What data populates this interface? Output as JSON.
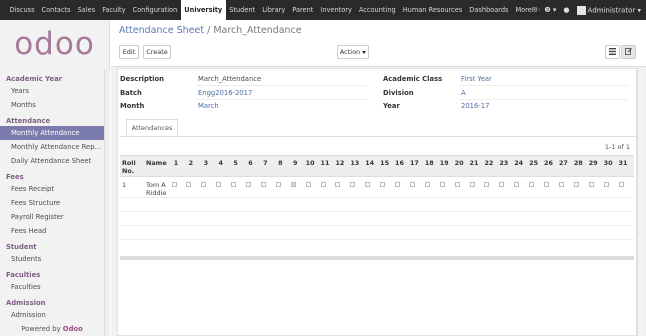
{
  "topnav": {
    "items": [
      "Discuss",
      "Contacts",
      "Sales",
      "Faculty",
      "Configuration",
      "University",
      "Student",
      "Library",
      "Parent",
      "Inventory",
      "Accounting",
      "Human Resources",
      "Dashboards",
      "More"
    ],
    "active": "University",
    "user": "Administrator",
    "icons": [
      "mail-icon",
      "help-icon",
      "chat-icon",
      "avatar"
    ]
  },
  "logo": "odoo",
  "sidebar": {
    "sections": [
      {
        "title": "Academic Year",
        "items": [
          "Years",
          "Months"
        ]
      },
      {
        "title": "Attendance",
        "items": [
          "Monthly Attendance",
          "Monthly Attendance Rep...",
          "Daily Attendance Sheet"
        ]
      },
      {
        "title": "Fees",
        "items": [
          "Fees Receipt",
          "Fees Structure",
          "Payroll Register",
          "Fees Head"
        ]
      },
      {
        "title": "Student",
        "items": [
          "Students"
        ]
      },
      {
        "title": "Faculties",
        "items": [
          "Faculties"
        ]
      },
      {
        "title": "Admission",
        "items": [
          "Admission"
        ]
      }
    ],
    "active_item": "Monthly Attendance",
    "powered_prefix": "Powered by",
    "powered_brand": "Odoo"
  },
  "breadcrumb": {
    "parent": "Attendance Sheet",
    "separator": "/",
    "current": "March_Attendance"
  },
  "toolbar": {
    "edit": "Edit",
    "create": "Create",
    "action": "Action",
    "list_icon": "list-icon",
    "form_icon": "edit-form-icon"
  },
  "form": {
    "description_label": "Description",
    "description_value": "March_Attendance",
    "batch_label": "Batch",
    "batch_value": "Engg2016-2017",
    "month_label": "Month",
    "month_value": "March",
    "academic_class_label": "Academic Class",
    "academic_class_value": "First Year",
    "division_label": "Division",
    "division_value": "A",
    "year_label": "Year",
    "year_value": "2016-17"
  },
  "tab": "Attendances",
  "pager": "1-1 of 1",
  "table": {
    "roll_label_1": "Roll",
    "roll_label_2": "No.",
    "name_label": "Name",
    "days": [
      "1",
      "2",
      "3",
      "4",
      "5",
      "6",
      "7",
      "8",
      "9",
      "10",
      "11",
      "12",
      "13",
      "14",
      "15",
      "16",
      "17",
      "18",
      "19",
      "20",
      "21",
      "22",
      "23",
      "24",
      "25",
      "26",
      "27",
      "28",
      "29",
      "30",
      "31"
    ],
    "rows": [
      {
        "roll": "1",
        "name_1": "Tom A",
        "name_2": "Riddie",
        "checked": [
          9
        ]
      }
    ]
  }
}
